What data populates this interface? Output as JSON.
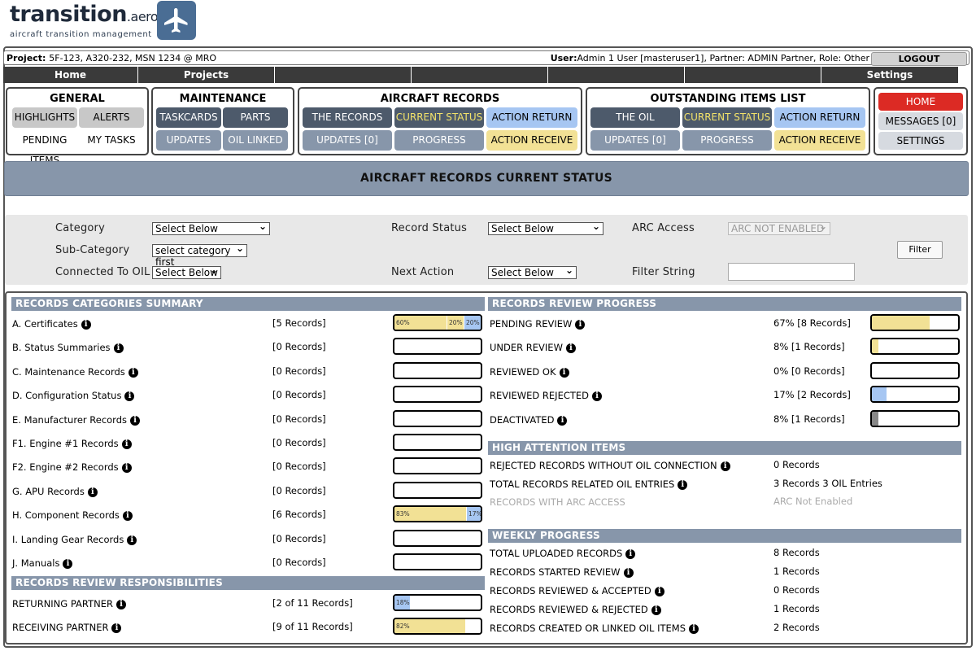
{
  "logo": {
    "brand": "transition",
    "suffix": ".aero",
    "tagline": "aircraft transition management"
  },
  "topbar": {
    "project_label": "Project:",
    "project": "5F-123, A320-232, MSN 1234 @ MRO",
    "user_label": "User:",
    "user": "Admin 1 User [masteruser1], Partner: ADMIN Partner, Role: Other",
    "logout": "LOGOUT"
  },
  "navbar": [
    "Home",
    "Projects",
    "",
    "",
    "",
    "",
    "Settings"
  ],
  "menus": {
    "general": {
      "title": "GENERAL",
      "highlights": "HIGHLIGHTS",
      "alerts": "ALERTS",
      "pending": "PENDING ITEMS",
      "mytasks": "MY TASKS"
    },
    "maintenance": {
      "title": "MAINTENANCE",
      "taskcards": "TASKCARDS",
      "parts": "PARTS",
      "updates": "UPDATES",
      "oil_linked": "OIL LINKED"
    },
    "aircraft_records": {
      "title": "AIRCRAFT RECORDS",
      "the_records": "THE RECORDS",
      "current_status": "CURRENT STATUS",
      "action_return": "ACTION RETURN",
      "updates": "UPDATES [0]",
      "progress": "PROGRESS",
      "action_receive": "ACTION RECEIVE"
    },
    "oil": {
      "title": "OUTSTANDING ITEMS LIST",
      "the_oil": "THE OIL",
      "current_status": "CURRENT STATUS",
      "action_return": "ACTION RETURN",
      "updates": "UPDATES [0]",
      "progress": "PROGRESS",
      "action_receive": "ACTION RECEIVE"
    },
    "side": {
      "home": "HOME",
      "messages": "MESSAGES [0]",
      "settings": "SETTINGS"
    }
  },
  "page_title": "AIRCRAFT RECORDS CURRENT STATUS",
  "filters": {
    "category_label": "Category",
    "category_value": "Select Below",
    "subcategory_label": "Sub-Category",
    "subcategory_value": "select category first",
    "oil_label": "Connected To OIL",
    "oil_value": "Select Below",
    "status_label": "Record Status",
    "status_value": "Select Below",
    "next_label": "Next Action",
    "next_value": "Select Below",
    "arc_label": "ARC Access",
    "arc_value": "ARC NOT ENABLED",
    "string_label": "Filter String",
    "string_value": "",
    "filter_button": "Filter"
  },
  "colors": {
    "returned": "#f2e195",
    "received": "#a6c6f2",
    "deactivated": "#888888",
    "nav_bg": "#3a3a3a",
    "section": "#8796aa",
    "home_red": "#dc2a24"
  },
  "categories": {
    "title": "RECORDS CATEGORIES SUMMARY",
    "rows": [
      {
        "label": "A. Certificates",
        "count": "[5 Records]",
        "segs": [
          {
            "pct": 60,
            "text": "60%",
            "color": "#f2e195"
          },
          {
            "pct": 20,
            "text": "20%",
            "color": "#f2e195"
          },
          {
            "pct": 20,
            "text": "20%",
            "color": "#a6c6f2"
          }
        ]
      },
      {
        "label": "B. Status Summaries",
        "count": "[0 Records]",
        "segs": []
      },
      {
        "label": "C. Maintenance Records",
        "count": "[0 Records]",
        "segs": []
      },
      {
        "label": "D. Configuration Status",
        "count": "[0 Records]",
        "segs": []
      },
      {
        "label": "E. Manufacturer Records",
        "count": "[0 Records]",
        "segs": []
      },
      {
        "label": "F1. Engine #1 Records",
        "count": "[0 Records]",
        "segs": []
      },
      {
        "label": "F2. Engine #2 Records",
        "count": "[0 Records]",
        "segs": []
      },
      {
        "label": "G. APU Records",
        "count": "[0 Records]",
        "segs": []
      },
      {
        "label": "H. Component Records",
        "count": "[6 Records]",
        "segs": [
          {
            "pct": 83,
            "text": "83%",
            "color": "#f2e195"
          },
          {
            "pct": 17,
            "text": "17%",
            "color": "#a6c6f2"
          }
        ]
      },
      {
        "label": "I. Landing Gear Records",
        "count": "[0 Records]",
        "segs": []
      },
      {
        "label": "J. Manuals",
        "count": "[0 Records]",
        "segs": []
      }
    ]
  },
  "responsibilities": {
    "title": "RECORDS REVIEW RESPONSIBILITIES",
    "rows": [
      {
        "label": "RETURNING PARTNER",
        "count": "[2 of 11 Records]",
        "segs": [
          {
            "pct": 18,
            "text": "18%",
            "color": "#a6c6f2"
          }
        ]
      },
      {
        "label": "RECEIVING PARTNER",
        "count": "[9 of 11 Records]",
        "segs": [
          {
            "pct": 82,
            "text": "82%",
            "color": "#f2e195"
          }
        ]
      }
    ]
  },
  "progress": {
    "title": "RECORDS REVIEW PROGRESS",
    "rows": [
      {
        "label": "PENDING REVIEW",
        "value": "67% [8 Records]",
        "segs": [
          {
            "pct": 67,
            "text": "",
            "color": "#f2e195"
          }
        ]
      },
      {
        "label": "UNDER REVIEW",
        "value": "8% [1 Records]",
        "segs": [
          {
            "pct": 8,
            "text": "",
            "color": "#f2e195"
          }
        ]
      },
      {
        "label": "REVIEWED OK",
        "value": "0% [0 Records]",
        "segs": []
      },
      {
        "label": "REVIEWED REJECTED",
        "value": "17% [2 Records]",
        "segs": [
          {
            "pct": 17,
            "text": "",
            "color": "#a6c6f2"
          }
        ]
      },
      {
        "label": "DEACTIVATED",
        "value": "8% [1 Records]",
        "segs": [
          {
            "pct": 8,
            "text": "",
            "color": "#888888"
          }
        ]
      }
    ]
  },
  "attention": {
    "title": "HIGH ATTENTION ITEMS",
    "rows": [
      {
        "label": "REJECTED RECORDS WITHOUT OIL CONNECTION",
        "value": "0 Records",
        "info": true,
        "muted": false
      },
      {
        "label": "TOTAL RECORDS RELATED OIL ENTRIES",
        "value": "3 Records 3 OIL Entries",
        "info": true,
        "muted": false
      },
      {
        "label": "RECORDS WITH ARC ACCESS",
        "value": "ARC Not Enabled",
        "info": false,
        "muted": true
      }
    ]
  },
  "weekly": {
    "title": "WEEKLY PROGRESS",
    "rows": [
      {
        "label": "TOTAL UPLOADED RECORDS",
        "value": "8 Records"
      },
      {
        "label": "RECORDS STARTED REVIEW",
        "value": "1 Records"
      },
      {
        "label": "RECORDS REVIEWED & ACCEPTED",
        "value": "0 Records"
      },
      {
        "label": "RECORDS REVIEWED & REJECTED",
        "value": "1 Records"
      },
      {
        "label": "RECORDS CREATED OR LINKED OIL ITEMS",
        "value": "2 Records"
      }
    ]
  }
}
